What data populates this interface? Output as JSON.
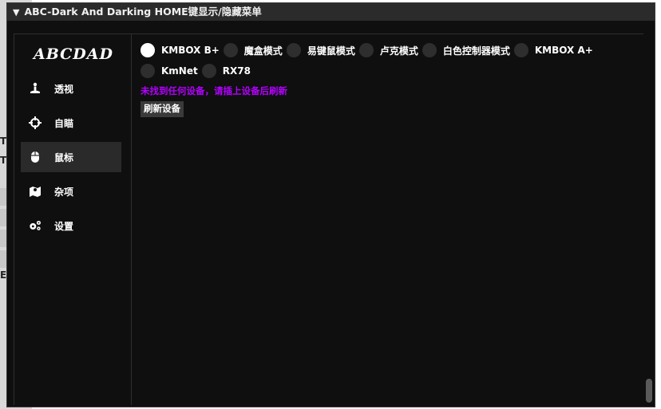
{
  "window": {
    "title": "ABC-Dark And Darking HOME键显示/隐藏菜单",
    "collapse_glyph": "▼"
  },
  "background_app": {
    "fragments": [
      "T",
      "T",
      "E"
    ]
  },
  "sidebar": {
    "logo": "ABCDAD",
    "items": [
      {
        "label": "透视",
        "icon": "person-icon",
        "active": false
      },
      {
        "label": "自瞄",
        "icon": "crosshair-icon",
        "active": false
      },
      {
        "label": "鼠标",
        "icon": "mouse-icon",
        "active": true
      },
      {
        "label": "杂项",
        "icon": "map-icon",
        "active": false
      },
      {
        "label": "设置",
        "icon": "gears-icon",
        "active": false
      }
    ]
  },
  "main": {
    "devices": [
      {
        "label": "KMBOX B+",
        "checked": true
      },
      {
        "label": "魔盒模式",
        "checked": false
      },
      {
        "label": "易键鼠模式",
        "checked": false
      },
      {
        "label": "卢克模式",
        "checked": false
      },
      {
        "label": "白色控制器模式",
        "checked": false
      },
      {
        "label": "KMBOX A+",
        "checked": false
      },
      {
        "label": "KmNet",
        "checked": false
      },
      {
        "label": "RX78",
        "checked": false
      }
    ],
    "status_text": "未找到任何设备，请插上设备后刷新",
    "refresh_label": "刷新设备"
  },
  "colors": {
    "status": "#b300ff",
    "active_nav": "#2a2a2a",
    "window_bg": "#0f0f0f"
  }
}
